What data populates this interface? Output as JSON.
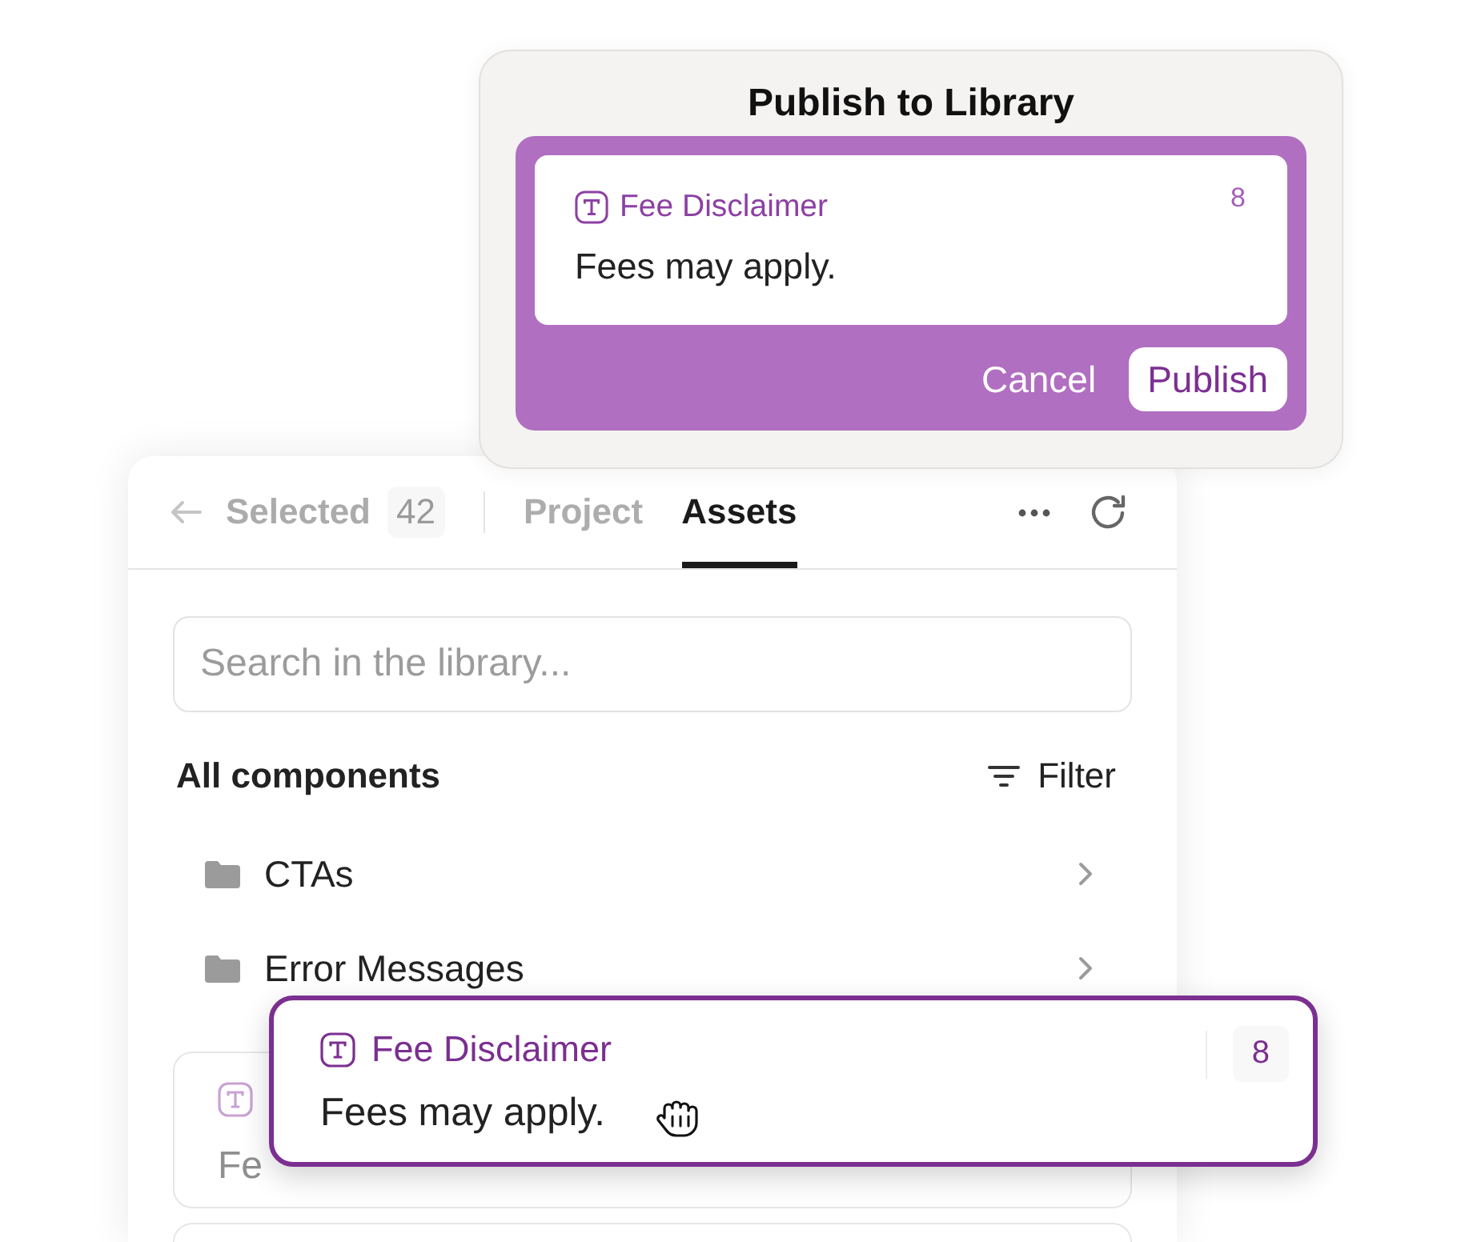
{
  "publish_dialog": {
    "title": "Publish to Library",
    "component": {
      "name": "Fee Disclaimer",
      "count": "8",
      "text": "Fees may apply."
    },
    "buttons": [
      {
        "label": "Cancel",
        "kind": "text"
      },
      {
        "label": "Publish",
        "kind": "primary"
      }
    ]
  },
  "panel": {
    "back_button": {
      "label": "Selected",
      "count": "42"
    },
    "tabs": [
      {
        "label": "Project",
        "selected": false
      },
      {
        "label": "Assets",
        "selected": true
      }
    ],
    "search": {
      "placeholder": "Search in the library..."
    },
    "section_title": "All components",
    "filter_label": "Filter",
    "folders": [
      {
        "name": "CTAs"
      },
      {
        "name": "Error Messages"
      }
    ],
    "components": [
      {
        "text": "Fe"
      }
    ]
  },
  "dragged_component": {
    "name": "Fee Disclaimer",
    "count": "8",
    "text": "Fees may apply."
  }
}
